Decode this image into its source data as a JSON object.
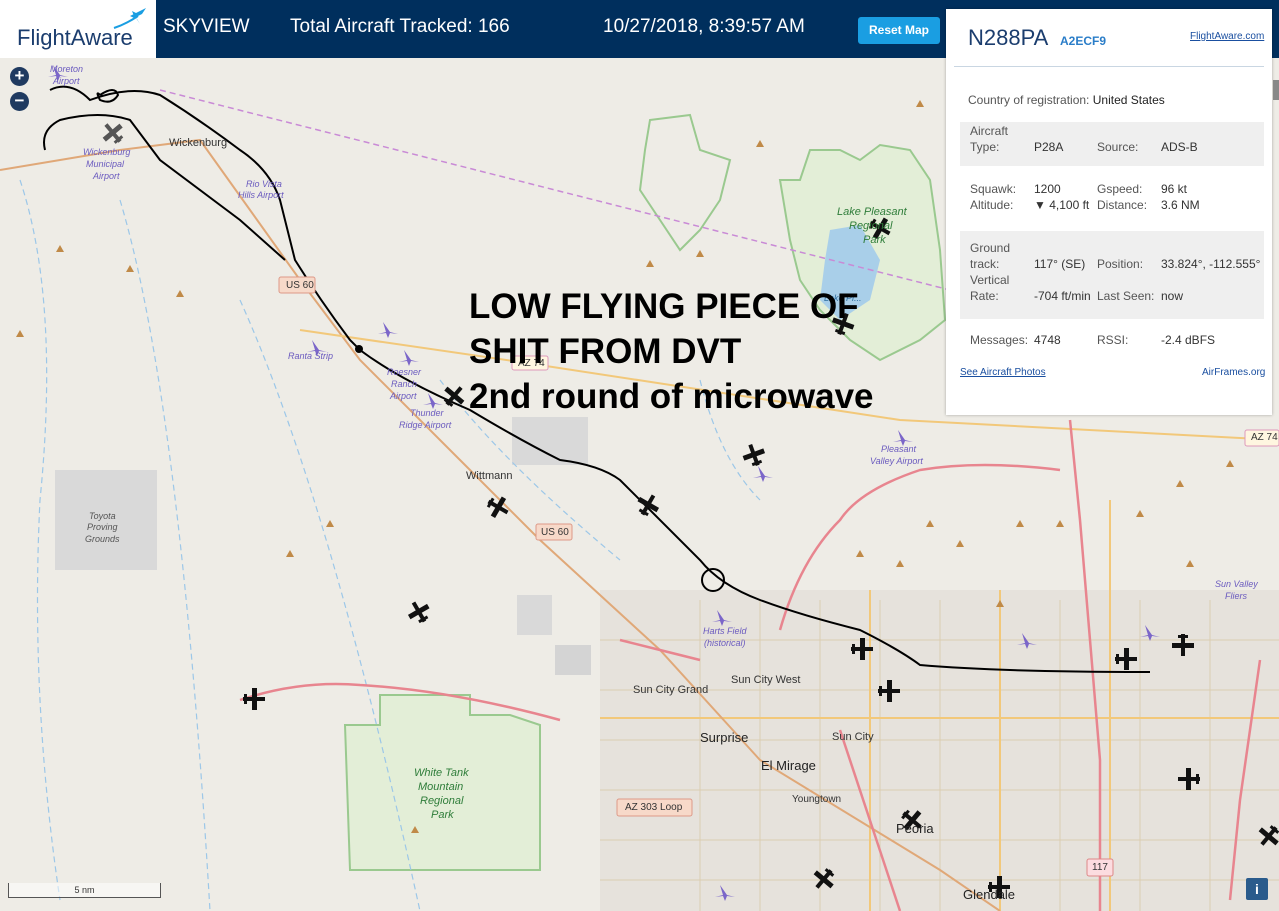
{
  "header": {
    "logo": "FlightAware",
    "app_name": "SKYVIEW",
    "total_label": "Total Aircraft Tracked: 166",
    "datetime": "10/27/2018, 8:39:57 AM",
    "reset_label": "Reset Map"
  },
  "zoom": {
    "in": "+",
    "out": "−"
  },
  "overlay": {
    "line1": "LOW FLYING PIECE OF",
    "line2": "SHIT FROM DVT",
    "line3": "2nd round of microwave"
  },
  "map_labels": {
    "moreton": "Moreton",
    "moreton_airport": "Airport",
    "wickenburg": "Wickenburg",
    "wickenburg_airport1": "Wickenburg",
    "wickenburg_airport2": "Municipal",
    "wickenburg_airport3": "Airport",
    "rio_vista1": "Rio Vista",
    "rio_vista2": "Hills Airport",
    "us60_a": "US 60",
    "us60_b": "US 60",
    "az74_a": "AZ 74",
    "az74_b": "AZ 74",
    "ranta": "Ranta Strip",
    "roesner1": "Roesner",
    "roesner2": "Ranch",
    "roesner3": "Airport",
    "thunder1": "Thunder",
    "thunder2": "Ridge Airport",
    "wittmann": "Wittmann",
    "toyota1": "Toyota",
    "toyota2": "Proving",
    "toyota3": "Grounds",
    "lake1": "Lake Pleasant",
    "lake2": "Regional",
    "lake3": "Park",
    "lake_small": "Lake Pl...",
    "pleasant1": "Pleasant",
    "pleasant2": "Valley Airport",
    "harts1": "Harts Field",
    "harts2": "(historical)",
    "sun_city_grand": "Sun City Grand",
    "sun_city_west": "Sun City West",
    "surprise": "Surprise",
    "el_mirage": "El Mirage",
    "sun_city": "Sun City",
    "youngtown": "Youngtown",
    "peoria": "Peoria",
    "glendale": "Glendale",
    "white_tank1": "White Tank",
    "white_tank2": "Mountain",
    "white_tank3": "Regional",
    "white_tank4": "Park",
    "az303": "AZ 303 Loop",
    "sun_valley1": "Sun Valley",
    "sun_valley2": "Fliers",
    "i117": "117"
  },
  "panel": {
    "registration": "N288PA",
    "hex": "A2ECF9",
    "fa_link": "FlightAware.com",
    "country_label": "Country of registration:",
    "country_value": "United States",
    "aircraft_type_label1": "Aircraft",
    "aircraft_type_label2": "Type:",
    "aircraft_type": "P28A",
    "source_label": "Source:",
    "source": "ADS-B",
    "squawk_label": "Squawk:",
    "squawk": "1200",
    "altitude_label": "Altitude:",
    "altitude": "▼ 4,100 ft",
    "gspeed_label": "Gspeed:",
    "gspeed": "96 kt",
    "distance_label": "Distance:",
    "distance": "3.6 NM",
    "ground_track_label1": "Ground",
    "ground_track_label2": "track:",
    "ground_track": "117° (SE)",
    "position_label": "Position:",
    "position": "33.824°, -112.555°",
    "vrate_label1": "Vertical",
    "vrate_label2": "Rate:",
    "vrate": "-704 ft/min",
    "last_seen_label": "Last Seen:",
    "last_seen": "now",
    "messages_label": "Messages:",
    "messages": "4748",
    "rssi_label": "RSSI:",
    "rssi": "-2.4 dBFS",
    "photos_link": "See Aircraft Photos",
    "airframes_link": "AirFrames.org"
  },
  "scale": "5 nm",
  "info": "i",
  "colors": {
    "header_bg": "#002f5d",
    "reset_button": "#1a9ee2",
    "map_bg": "#eeece6",
    "lake": "#a9cfe9",
    "park_border": "#9ac98f",
    "highway": "#e8858f",
    "flight_track": "#000000"
  }
}
